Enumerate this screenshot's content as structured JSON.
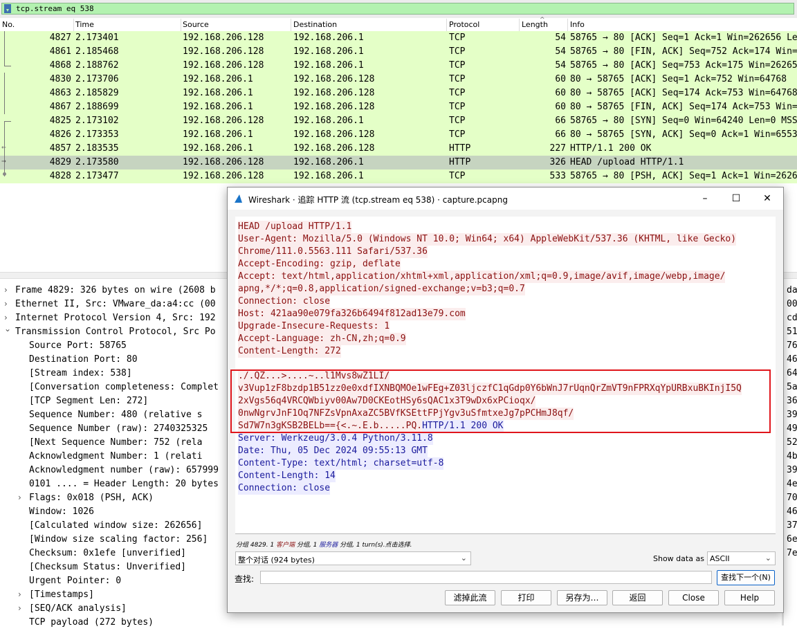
{
  "filter": {
    "text": "tcp.stream eq 538"
  },
  "packet_list": {
    "columns": [
      "No.",
      "Time",
      "Source",
      "Destination",
      "Protocol",
      "Length",
      "Info"
    ],
    "rows": [
      {
        "no": "4827",
        "time": "2.173401",
        "src": "192.168.206.128",
        "dst": "192.168.206.1",
        "proto": "TCP",
        "len": "54",
        "info": "58765 → 80 [ACK] Seq=1 Ack=1 Win=262656 Len=0"
      },
      {
        "no": "4861",
        "time": "2.185468",
        "src": "192.168.206.128",
        "dst": "192.168.206.1",
        "proto": "TCP",
        "len": "54",
        "info": "58765 → 80 [FIN, ACK] Seq=752 Ack=174 Win=262656"
      },
      {
        "no": "4868",
        "time": "2.188762",
        "src": "192.168.206.128",
        "dst": "192.168.206.1",
        "proto": "TCP",
        "len": "54",
        "info": "58765 → 80 [ACK] Seq=753 Ack=175 Win=262656"
      },
      {
        "no": "4830",
        "time": "2.173706",
        "src": "192.168.206.1",
        "dst": "192.168.206.128",
        "proto": "TCP",
        "len": "60",
        "info": "80 → 58765 [ACK] Seq=1 Ack=752 Win=64768"
      },
      {
        "no": "4863",
        "time": "2.185829",
        "src": "192.168.206.1",
        "dst": "192.168.206.128",
        "proto": "TCP",
        "len": "60",
        "info": "80 → 58765 [ACK] Seq=174 Ack=753 Win=64768"
      },
      {
        "no": "4867",
        "time": "2.188699",
        "src": "192.168.206.1",
        "dst": "192.168.206.128",
        "proto": "TCP",
        "len": "60",
        "info": "80 → 58765 [FIN, ACK] Seq=174 Ack=753 Win=64768"
      },
      {
        "no": "4825",
        "time": "2.173102",
        "src": "192.168.206.128",
        "dst": "192.168.206.1",
        "proto": "TCP",
        "len": "66",
        "info": "58765 → 80 [SYN] Seq=0 Win=64240 Len=0 MSS=1460"
      },
      {
        "no": "4826",
        "time": "2.173353",
        "src": "192.168.206.1",
        "dst": "192.168.206.128",
        "proto": "TCP",
        "len": "66",
        "info": "80 → 58765 [SYN, ACK] Seq=0 Ack=1 Win=65535"
      },
      {
        "no": "4857",
        "time": "2.183535",
        "src": "192.168.206.1",
        "dst": "192.168.206.128",
        "proto": "HTTP",
        "len": "227",
        "info": "HTTP/1.1 200 OK"
      },
      {
        "no": "4829",
        "time": "2.173580",
        "src": "192.168.206.128",
        "dst": "192.168.206.1",
        "proto": "HTTP",
        "len": "326",
        "info": "HEAD /upload HTTP/1.1"
      },
      {
        "no": "4828",
        "time": "2.173477",
        "src": "192.168.206.128",
        "dst": "192.168.206.1",
        "proto": "TCP",
        "len": "533",
        "info": "58765 → 80 [PSH, ACK] Seq=1 Ack=1 Win=262656"
      }
    ]
  },
  "details": [
    {
      "text": "Frame 4829: 326 bytes on wire (2608 b",
      "arrow": "›"
    },
    {
      "text": "Ethernet II, Src: VMware_da:a4:cc (00",
      "arrow": "›"
    },
    {
      "text": "Internet Protocol Version 4, Src: 192",
      "arrow": "›"
    },
    {
      "text": "Transmission Control Protocol, Src Po",
      "arrow": "⌄"
    },
    {
      "text": "Source Port: 58765",
      "arrow": ""
    },
    {
      "text": "Destination Port: 80",
      "arrow": ""
    },
    {
      "text": "[Stream index: 538]",
      "arrow": ""
    },
    {
      "text": "[Conversation completeness: Complet",
      "arrow": ""
    },
    {
      "text": "[TCP Segment Len: 272]",
      "arrow": ""
    },
    {
      "text": "Sequence Number: 480    (relative s",
      "arrow": ""
    },
    {
      "text": "Sequence Number (raw): 2740325325",
      "arrow": ""
    },
    {
      "text": "[Next Sequence Number: 752    (rela",
      "arrow": ""
    },
    {
      "text": "Acknowledgment Number: 1    (relati",
      "arrow": ""
    },
    {
      "text": "Acknowledgment number (raw): 657999",
      "arrow": ""
    },
    {
      "text": "0101 .... = Header Length: 20 bytes",
      "arrow": ""
    },
    {
      "text": "Flags: 0x018 (PSH, ACK)",
      "arrow": "›"
    },
    {
      "text": "Window: 1026",
      "arrow": ""
    },
    {
      "text": "[Calculated window size: 262656]",
      "arrow": ""
    },
    {
      "text": "[Window size scaling factor: 256]",
      "arrow": ""
    },
    {
      "text": "Checksum: 0x1efe [unverified]",
      "arrow": ""
    },
    {
      "text": "[Checksum Status: Unverified]",
      "arrow": ""
    },
    {
      "text": "Urgent Pointer: 0",
      "arrow": ""
    },
    {
      "text": "[Timestamps]",
      "arrow": "›"
    },
    {
      "text": "[SEQ/ACK analysis]",
      "arrow": "›"
    },
    {
      "text": "TCP payload (272 bytes)",
      "arrow": ""
    }
  ],
  "hex_column": [
    "da",
    "00",
    "cd",
    "51",
    "76",
    "46",
    "64",
    "5a",
    "36",
    "39",
    "49",
    "52",
    "4b",
    "39",
    "4e",
    "70",
    "46",
    "37",
    "6e",
    "7e"
  ],
  "dialog": {
    "title": "Wireshark · 追踪 HTTP 流 (tcp.stream eq 538) · capture.pcapng",
    "minimize": "–",
    "maximize": "☐",
    "close": "✕",
    "request_lines": [
      "HEAD /upload HTTP/1.1",
      "User-Agent: Mozilla/5.0 (Windows NT 10.0; Win64; x64) AppleWebKit/537.36 (KHTML, like Gecko)",
      "Chrome/111.0.5563.111 Safari/537.36",
      "Accept-Encoding: gzip, deflate",
      "Accept: text/html,application/xhtml+xml,application/xml;q=0.9,image/avif,image/webp,image/",
      "apng,*/*;q=0.8,application/signed-exchange;v=b3;q=0.7",
      "Connection: close",
      "Host: 421aa90e079fa326b6494f812ad13e79.com",
      "Upgrade-Insecure-Requests: 1",
      "Accept-Language: zh-CN,zh;q=0.9",
      "Content-Length: 272"
    ],
    "payload_lines": [
      "./.QZ...>....~..l1Mvs8wZ1LI/",
      "v3Vup1zF8bzdp1B51zz0e0xdfIXNBQMOe1wFEg+Z03ljczfC1qGdp0Y6bWnJ7rUqnQrZmVT9nFPRXqYpURBxuBKInjI5Q",
      "2xVgs56q4VRCQWbiyv00Aw7D0CKEotHSy6sQAC1x3T9wDx6xPCioqx/",
      "0nwNgrvJnF1Oq7NFZsVpnAxaZC5BVfKSEttFPjYgv3uSfmtxeJg7pPCHmJ8qf/"
    ],
    "payload_last_req": "Sd7W7n3gKSB2BELb=={<.~.E.b.....PQ.",
    "payload_last_resp": "HTTP/1.1 200 OK",
    "response_lines": [
      "Server: Werkzeug/3.0.4 Python/3.11.8",
      "Date: Thu, 05 Dec 2024 09:55:13 GMT",
      "Content-Type: text/html; charset=utf-8",
      "Content-Length: 14",
      "Connection: close"
    ],
    "status_prefix": "分组 4829. 1 ",
    "status_client": "客户端",
    "status_mid": " 分组, 1 ",
    "status_server": "服务器",
    "status_suffix": " 分组, 1 turn(s).点击选择.",
    "conversation_select": "整个对话 (924 bytes)",
    "show_data_label": "Show data as",
    "show_data_value": "ASCII",
    "find_label": "查找:",
    "find_value": "",
    "find_next": "查找下一个(N)",
    "buttons": [
      "滤掉此流",
      "打印",
      "另存为…",
      "返回",
      "Close",
      "Help"
    ]
  }
}
